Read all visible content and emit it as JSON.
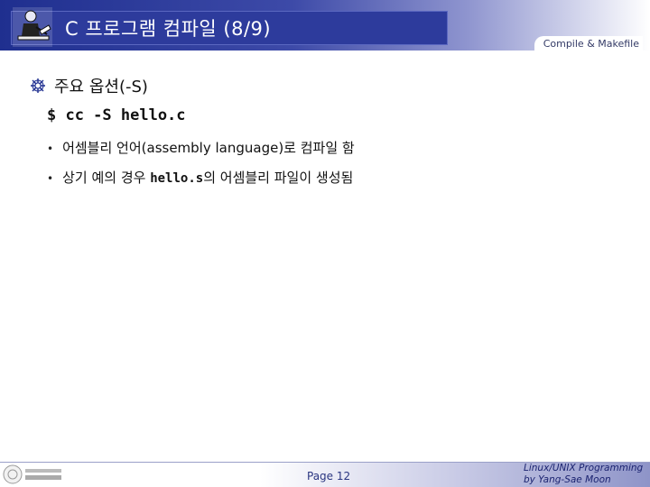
{
  "header": {
    "title": "C 프로그램 컴파일 (8/9)",
    "label": "Compile & Makefile"
  },
  "section": {
    "title": "주요 옵션(-S)",
    "code": "$ cc -S hello.c"
  },
  "bullets": [
    {
      "text": "어셈블리 언어(assembly language)로 컴파일 함"
    },
    {
      "prefix": "상기 예의 경우 ",
      "code": "hello.s",
      "suffix": "의 어셈블리 파일이 생성됨"
    }
  ],
  "footer": {
    "page": "Page 12",
    "credit_line1": "Linux/UNIX Programming",
    "credit_line2": "by Yang-Sae Moon"
  },
  "colors": {
    "title_bg": "#2d3b9c",
    "accent": "#1f2f8f"
  }
}
